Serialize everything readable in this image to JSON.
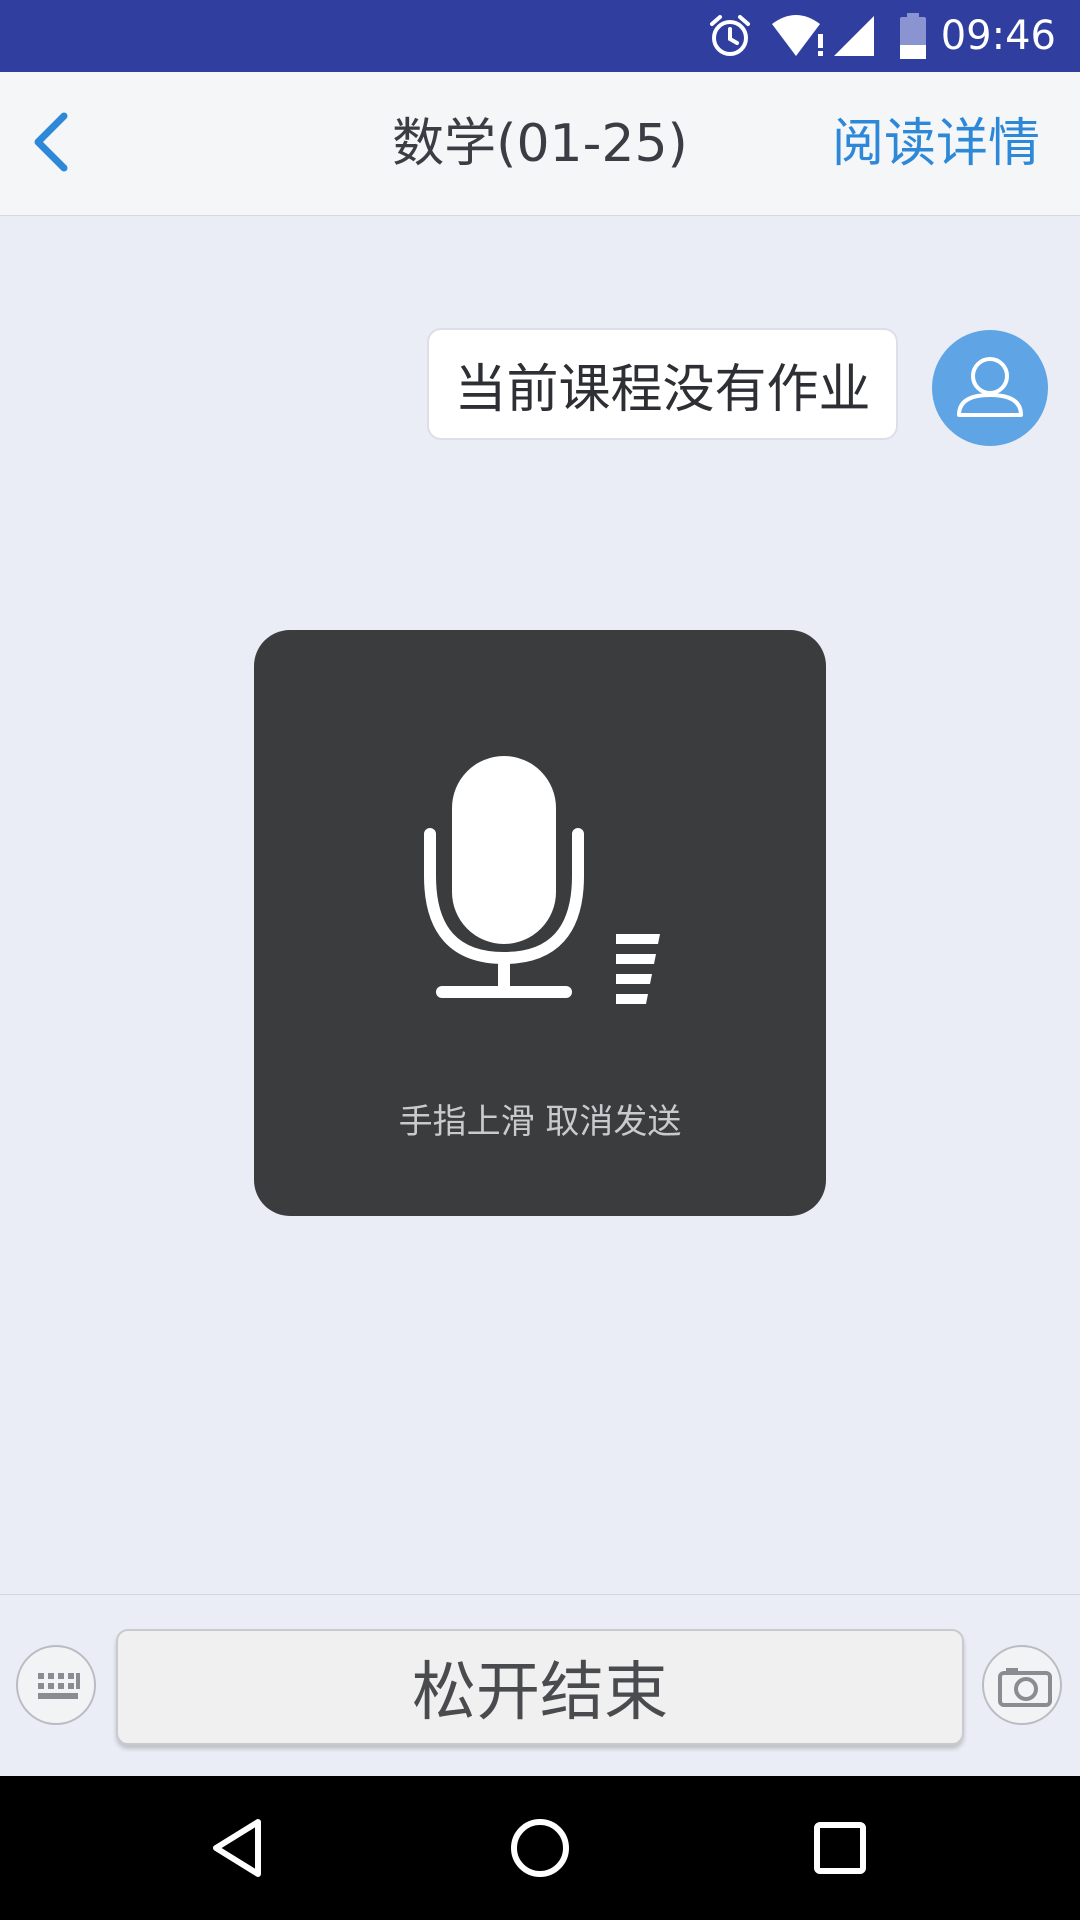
{
  "status_bar": {
    "time": "09:46",
    "icons": [
      "alarm-icon",
      "wifi-alert-icon",
      "signal-icon",
      "battery-icon"
    ],
    "background": "#303f9f"
  },
  "header": {
    "back_icon": "chevron-left-icon",
    "title": "数学(01-25)",
    "read_detail": "阅读详情",
    "accent": "#2e88d8"
  },
  "messages": [
    {
      "text": "当前课程没有作业",
      "avatar_icon": "user-icon",
      "avatar_color": "#5fa5e5"
    }
  ],
  "record_overlay": {
    "icon": "microphone-icon",
    "level_icon": "volume-level-icon",
    "hint": "手指上滑 取消发送"
  },
  "input_bar": {
    "keyboard_icon": "keyboard-icon",
    "hold_button_label": "松开结束",
    "camera_icon": "camera-icon"
  },
  "nav_bar": {
    "icons": [
      "back-triangle-icon",
      "home-circle-icon",
      "recents-square-icon"
    ]
  }
}
